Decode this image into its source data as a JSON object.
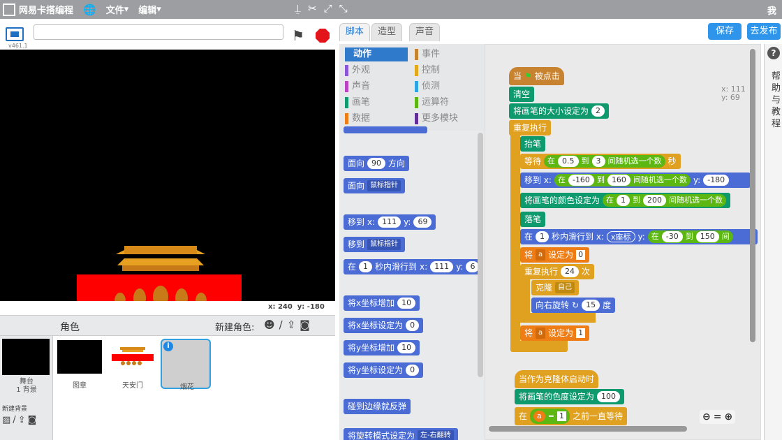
{
  "app": {
    "title": "网易卡搭编程",
    "menu_file": "文件",
    "menu_edit": "编辑",
    "user": "我",
    "version": "v461.1"
  },
  "stage": {
    "x_label": "x:",
    "x_value": "240",
    "y_label": "y:",
    "y_value": "-180"
  },
  "sprites_panel": {
    "title": "角色",
    "new_sprite": "新建角色:",
    "stage_label": "舞台",
    "stage_backdrops": "1 背景",
    "new_backdrop": "新建背景"
  },
  "sprites": [
    {
      "name": "图章"
    },
    {
      "name": "天安门"
    },
    {
      "name": "烟花"
    }
  ],
  "tabs": [
    "脚本",
    "造型",
    "声音"
  ],
  "buttons": {
    "save": "保存",
    "publish": "去发布"
  },
  "categories": [
    {
      "label": "动作",
      "color": "#4a6cd4"
    },
    {
      "label": "事件",
      "color": "#c88330"
    },
    {
      "label": "外观",
      "color": "#8a55d7"
    },
    {
      "label": "控制",
      "color": "#e1a91a"
    },
    {
      "label": "声音",
      "color": "#bb42c3"
    },
    {
      "label": "侦测",
      "color": "#2ca5e2"
    },
    {
      "label": "画笔",
      "color": "#0e9a6c"
    },
    {
      "label": "运算符",
      "color": "#5cb712"
    },
    {
      "label": "数据",
      "color": "#ee7d16"
    },
    {
      "label": "更多模块",
      "color": "#632d99"
    }
  ],
  "palette": {
    "face": "面向",
    "face_val": "90",
    "direction": "方向",
    "toward": "鼠标指针",
    "goto": "移到",
    "x": "x:",
    "xv": "111",
    "y": "y:",
    "yv": "69",
    "in": "在",
    "glide_n": "1",
    "glide_txt": "秒内滑行到",
    "glide_y": "y:",
    "glide_yv": "6",
    "chx": "将x坐标增加",
    "chx_v": "10",
    "setx": "将x坐标设定为",
    "setx_v": "0",
    "chy": "将y坐标增加",
    "chy_v": "10",
    "sety": "将y坐标设定为",
    "sety_v": "0",
    "bounce": "碰到边缘就反弹",
    "rot": "将旋转模式设定为",
    "rot_v": "左-右翻转"
  },
  "script": {
    "xy_x": "x: 111",
    "xy_y": "y: 69",
    "when": "当",
    "clicked": "被点击",
    "clear": "清空",
    "pen_size": "将画笔的大小设定为",
    "pen_size_v": "2",
    "forever": "重复执行",
    "pen_up": "抬笔",
    "wait": "等待",
    "in": "在",
    "w_a": "0.5",
    "to": "到",
    "w_b": "3",
    "pick": "间随机选一个数",
    "sec": "秒",
    "goto": "移到 x:",
    "g_a": "-160",
    "g_b": "160",
    "gy": "y:",
    "gy_v": "-180",
    "pen_color": "将画笔的颜色设定为",
    "c_a": "1",
    "c_b": "200",
    "pen_down": "落笔",
    "glide": "秒内滑行到 x:",
    "glide_n": "1",
    "xpos": "x座标",
    "glide_y": "y:",
    "gl_a": "-30",
    "gl_b": "150",
    "gl_trunc": "间",
    "set": "将",
    "var_a": "a",
    "set_to": "设定为",
    "set_v0": "0",
    "set_v1": "1",
    "repeat": "重复执行",
    "repeat_n": "24",
    "times": "次",
    "clone": "克隆",
    "self": "自己",
    "turn": "向右旋转",
    "turn_v": "15",
    "deg": "度",
    "clone_start": "当作为克隆体启动时",
    "pen_shade": "将画笔的色度设定为",
    "shade_v": "100",
    "until": "在",
    "eq": "=",
    "eq_v": "1",
    "until_txt": "之前一直等待"
  },
  "help": "帮助与教程"
}
